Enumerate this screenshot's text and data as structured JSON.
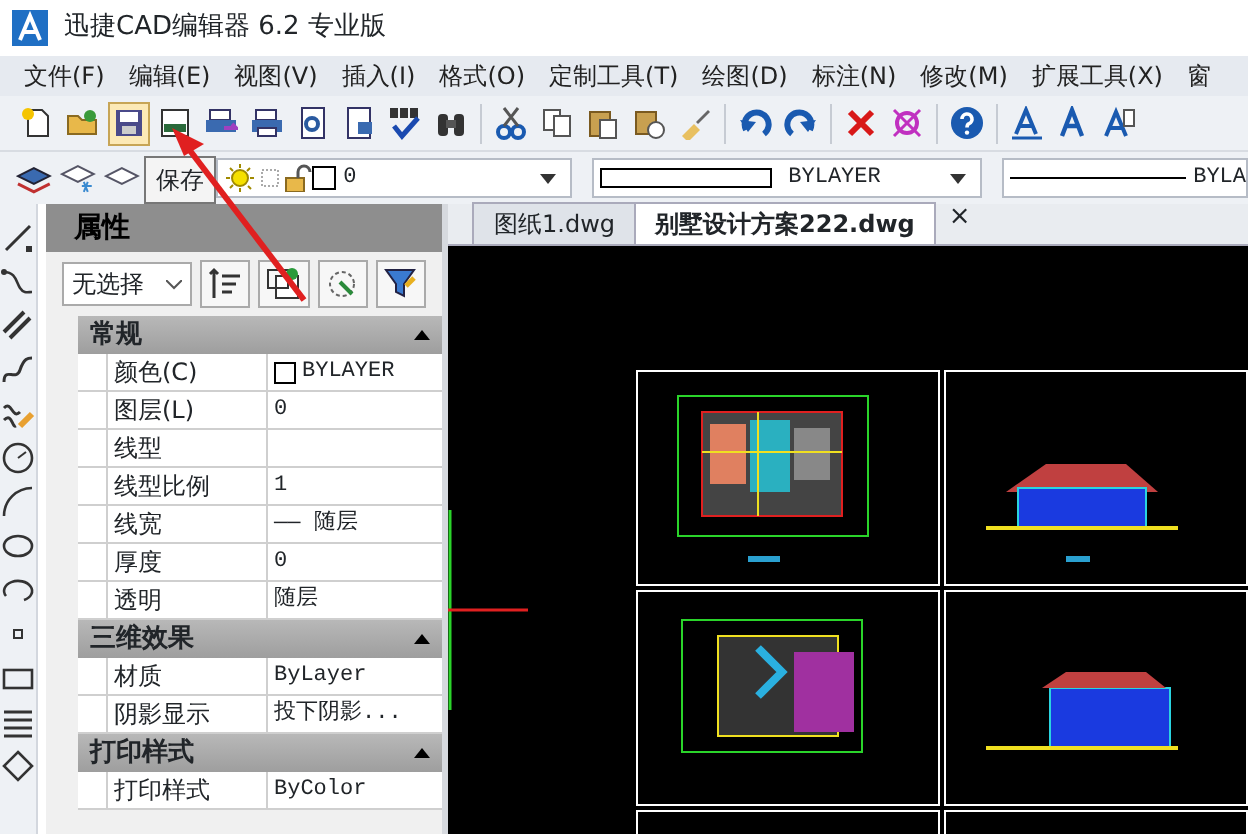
{
  "window": {
    "title": "迅捷CAD编辑器 6.2 专业版"
  },
  "menu": [
    "文件(F)",
    "编辑(E)",
    "视图(V)",
    "插入(I)",
    "格式(O)",
    "定制工具(T)",
    "绘图(D)",
    "标注(N)",
    "修改(M)",
    "扩展工具(X)",
    "窗"
  ],
  "toolbar_buttons": [
    {
      "highlighted": false
    },
    {
      "highlighted": false
    },
    {
      "highlighted": true
    },
    {
      "highlighted": false
    },
    {
      "highlighted": false
    },
    {
      "highlighted": false
    },
    {
      "highlighted": false
    },
    {
      "highlighted": false
    },
    {
      "highlighted": false
    },
    {
      "highlighted": false
    },
    {
      "highlighted": false
    },
    {
      "highlighted": false
    },
    {
      "highlighted": false
    },
    {
      "highlighted": false
    },
    {
      "highlighted": false
    },
    {
      "highlighted": false
    },
    {
      "highlighted": false
    },
    {
      "highlighted": false
    },
    {
      "highlighted": false
    },
    {
      "highlighted": false
    },
    {
      "highlighted": false
    },
    {
      "highlighted": false
    },
    {
      "highlighted": false
    }
  ],
  "tooltip": "保存",
  "layer_combo": {
    "value": "0"
  },
  "color_combo": {
    "value": "BYLAYER"
  },
  "linetype_combo": {
    "value": "BYLA"
  },
  "properties": {
    "title": "属性",
    "selector": "无选择",
    "sections": [
      {
        "name": "常规",
        "expanded": true,
        "rows": [
          {
            "label": "颜色(C)",
            "value": "BYLAYER",
            "kind": "color"
          },
          {
            "label": "图层(L)",
            "value": "0",
            "kind": "text"
          },
          {
            "label": "线型",
            "kind": "text"
          },
          {
            "label": "线型比例",
            "value": "1",
            "kind": "text"
          },
          {
            "label": "线宽",
            "value": "—— 随层",
            "kind": "text"
          },
          {
            "label": "厚度",
            "value": "0",
            "kind": "text"
          },
          {
            "label": "透明",
            "value": "随层",
            "kind": "text"
          }
        ]
      },
      {
        "name": "三维效果",
        "expanded": true,
        "rows": [
          {
            "label": "材质",
            "value": "ByLayer",
            "kind": "text"
          },
          {
            "label": "阴影显示",
            "value": "投下阴影...",
            "kind": "text"
          }
        ]
      },
      {
        "name": "打印样式",
        "expanded": true,
        "rows": [
          {
            "label": "打印样式",
            "value": "ByColor",
            "kind": "text"
          }
        ]
      }
    ]
  },
  "tabs": [
    {
      "label": "图纸1.dwg",
      "selected": false
    },
    {
      "label": "别墅设计方案222.dwg",
      "selected": true
    }
  ],
  "tab_close": "×"
}
